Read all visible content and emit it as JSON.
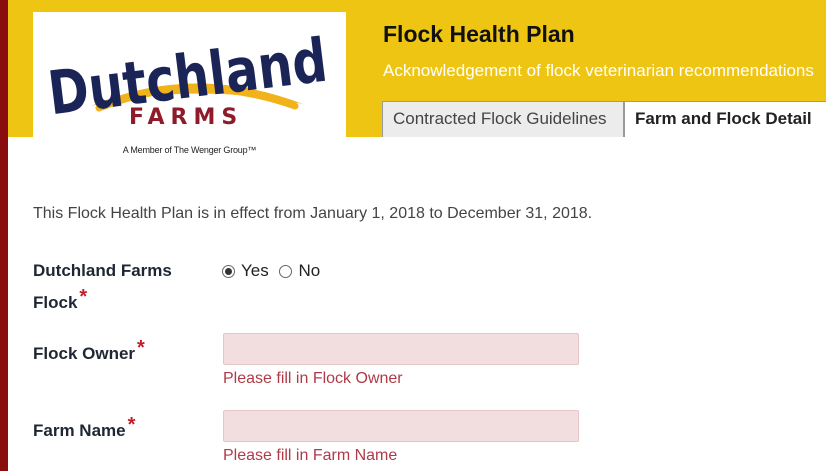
{
  "logo": {
    "wordmark": "Dutchland",
    "subword": "FARMS",
    "tagline": "A Member of The Wenger Group™"
  },
  "header": {
    "title": "Flock Health Plan",
    "subtitle": "Acknowledgement of flock veterinarian recommendations"
  },
  "tabs": [
    {
      "label": "Contracted Flock Guidelines",
      "active": false
    },
    {
      "label": "Farm and Flock Detail",
      "active": true
    }
  ],
  "form": {
    "effective_text": "This Flock Health Plan is in effect from January 1, 2018 to December 31, 2018.",
    "dutchland_flock": {
      "label_line1": "Dutchland Farms",
      "label_line2": "Flock",
      "required_mark": "*",
      "options": [
        {
          "label": "Yes",
          "checked": true
        },
        {
          "label": "No",
          "checked": false
        }
      ]
    },
    "flock_owner": {
      "label": "Flock Owner",
      "required_mark": "*",
      "value": "",
      "error": "Please fill in Flock Owner"
    },
    "farm_name": {
      "label": "Farm Name",
      "required_mark": "*",
      "value": "",
      "error": "Please fill in Farm Name"
    }
  },
  "colors": {
    "header_yellow": "#efc514",
    "left_rail": "#8b0e0e",
    "logo_navy": "#1b2456",
    "logo_maroon": "#8f1b2a",
    "logo_swoosh": "#f2b21a",
    "required": "#c21d2b",
    "error_text": "#b03a48",
    "input_error_bg": "#f2dede"
  }
}
